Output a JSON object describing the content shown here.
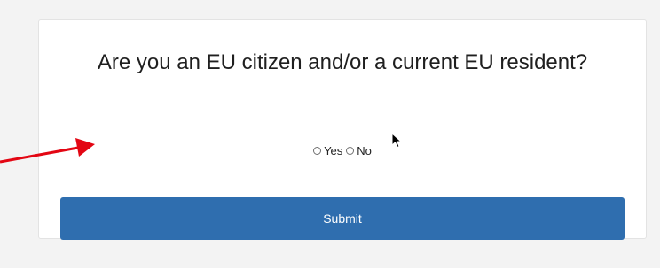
{
  "form": {
    "question": "Are you an EU citizen and/or a current EU resident?",
    "options": [
      {
        "label": "Yes",
        "selected": false
      },
      {
        "label": "No",
        "selected": false
      }
    ],
    "submit_label": "Submit"
  },
  "icons": {
    "cursor": "mouse-pointer-icon",
    "annotation": "red-arrow-icon"
  },
  "colors": {
    "submit_background": "#2f6eaf",
    "annotation_arrow": "#e30613"
  }
}
